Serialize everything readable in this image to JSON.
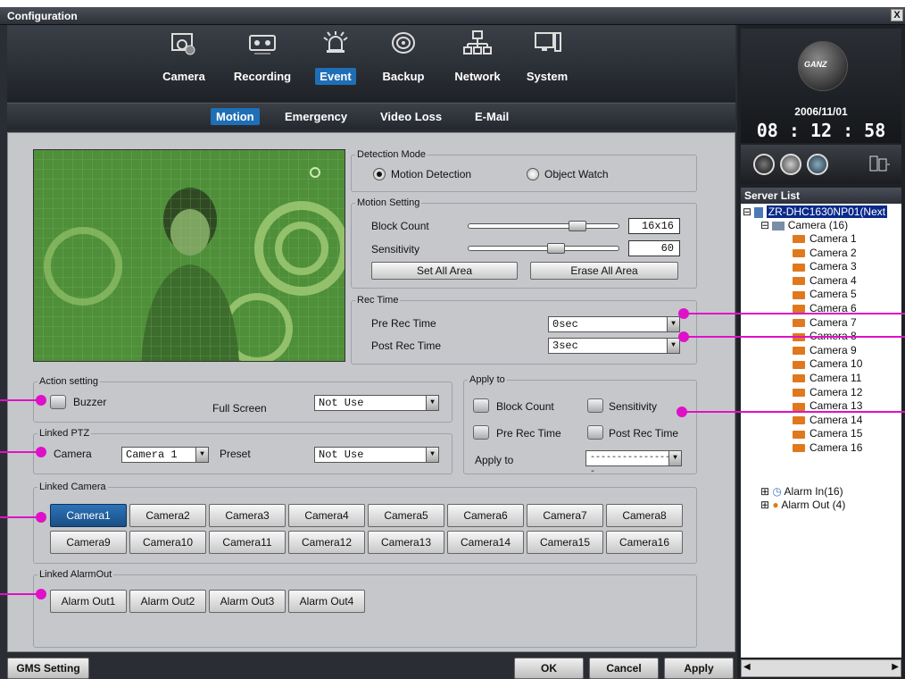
{
  "window": {
    "title": "Configuration",
    "close": "X"
  },
  "nav": {
    "tabs": [
      {
        "label": "Camera",
        "icon": "camera-icon"
      },
      {
        "label": "Recording",
        "icon": "recording-icon"
      },
      {
        "label": "Event",
        "icon": "event-alarm-icon"
      },
      {
        "label": "Backup",
        "icon": "backup-disk-icon"
      },
      {
        "label": "Network",
        "icon": "network-icon"
      },
      {
        "label": "System",
        "icon": "system-icon"
      }
    ],
    "active": "Event"
  },
  "subnav": {
    "tabs": [
      "Motion",
      "Emergency",
      "Video Loss",
      "E-Mail"
    ],
    "active": "Motion"
  },
  "detection_mode": {
    "title": "Detection Mode",
    "options": [
      "Motion Detection",
      "Object Watch"
    ],
    "selected": "Motion Detection"
  },
  "motion_setting": {
    "title": "Motion Setting",
    "block_count_label": "Block Count",
    "block_count_value": "16x16",
    "block_count_level": 0.7,
    "sensitivity_label": "Sensitivity",
    "sensitivity_value": "60",
    "sensitivity_level": 0.6,
    "set_all_label": "Set All Area",
    "erase_all_label": "Erase All Area"
  },
  "rec_time": {
    "title": "Rec Time",
    "pre_label": "Pre Rec Time",
    "pre_value": "0sec",
    "post_label": "Post Rec Time",
    "post_value": "3sec"
  },
  "action_setting": {
    "title": "Action setting",
    "buzzer_label": "Buzzer",
    "full_screen_label": "Full Screen",
    "full_screen_value": "Not Use"
  },
  "linked_ptz": {
    "title": "Linked PTZ",
    "camera_label": "Camera",
    "camera_value": "Camera 1",
    "preset_label": "Preset",
    "preset_value": "Not Use"
  },
  "apply_to": {
    "title": "Apply to",
    "block_count": "Block Count",
    "sensitivity": "Sensitivity",
    "pre_rec_time": "Pre Rec Time",
    "post_rec_time": "Post Rec Time",
    "apply_label": "Apply to",
    "apply_value": "-----------------"
  },
  "linked_camera": {
    "title": "Linked Camera",
    "cameras": [
      "Camera1",
      "Camera2",
      "Camera3",
      "Camera4",
      "Camera5",
      "Camera6",
      "Camera7",
      "Camera8",
      "Camera9",
      "Camera10",
      "Camera11",
      "Camera12",
      "Camera13",
      "Camera14",
      "Camera15",
      "Camera16"
    ],
    "active": "Camera1"
  },
  "linked_alarm": {
    "title": "Linked AlarmOut",
    "outs": [
      "Alarm Out1",
      "Alarm Out2",
      "Alarm Out3",
      "Alarm Out4"
    ]
  },
  "bottom": {
    "gms": "GMS Setting",
    "ok": "OK",
    "cancel": "Cancel",
    "apply": "Apply"
  },
  "clock": {
    "logo": "GANZ",
    "date": "2006/11/01",
    "time": "08 : 12 : 58"
  },
  "server_list": {
    "title": "Server List",
    "server": "ZR-DHC1630NP01(Next",
    "camera_group": "Camera (16)",
    "cameras": [
      "Camera 1",
      "Camera 2",
      "Camera 3",
      "Camera 4",
      "Camera 5",
      "Camera 6",
      "Camera 7",
      "Camera 8",
      "Camera 9",
      "Camera 10",
      "Camera 11",
      "Camera 12",
      "Camera 13",
      "Camera 14",
      "Camera 15",
      "Camera 16"
    ],
    "alarm_in": "Alarm In(16)",
    "alarm_out": "Alarm Out (4)"
  },
  "colors": {
    "accent": "#1f6fb6",
    "annotation": "#e010c8",
    "panel": "#c5c7cb",
    "video_tint": "#4f8f3a"
  }
}
